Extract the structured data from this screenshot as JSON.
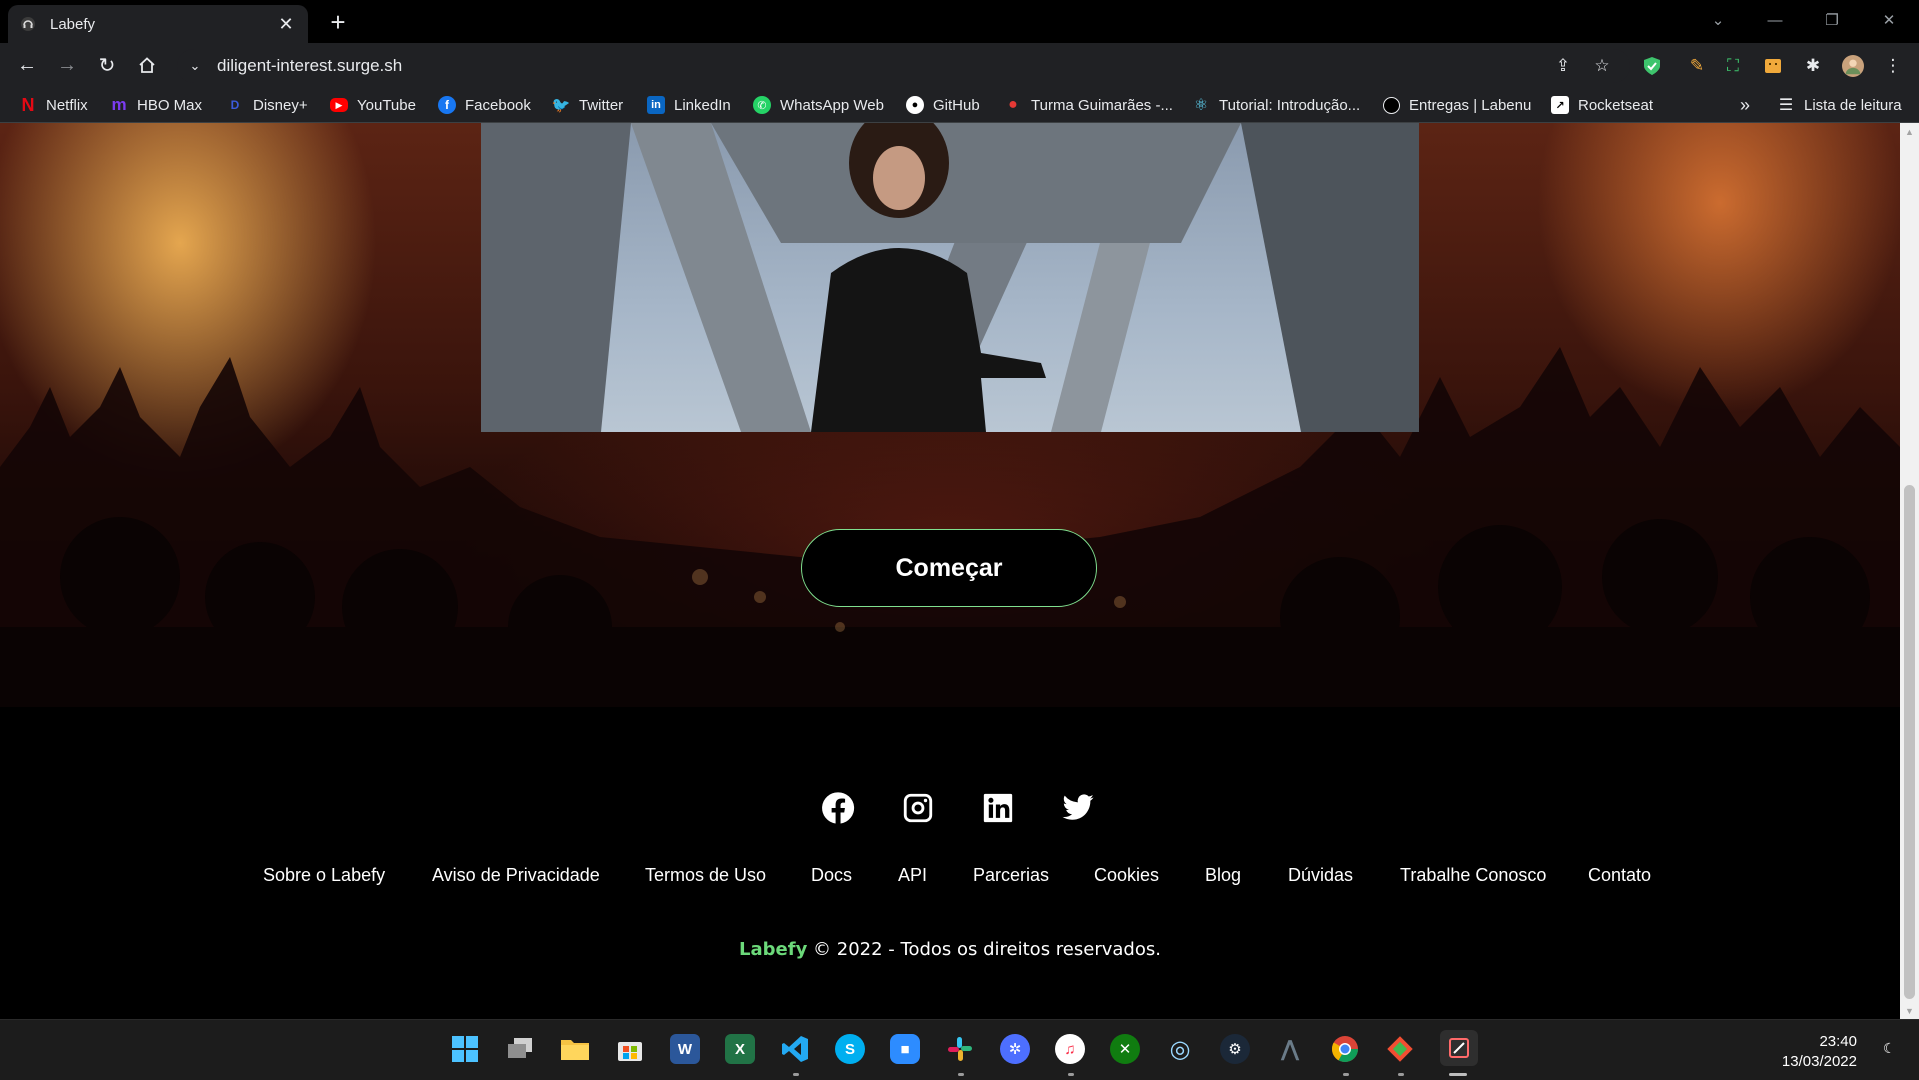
{
  "browser": {
    "tab_title": "Labefy",
    "url": "diligent-interest.surge.sh",
    "bookmarks": [
      {
        "label": "Netflix",
        "icon": "netflix-icon",
        "color": "#e50914"
      },
      {
        "label": "HBO Max",
        "icon": "hbo-max-icon",
        "color": "#5a2be2"
      },
      {
        "label": "Disney+",
        "icon": "disney-plus-icon",
        "color": "#1c3bb5"
      },
      {
        "label": "YouTube",
        "icon": "youtube-icon",
        "color": "#ff0000"
      },
      {
        "label": "Facebook",
        "icon": "facebook-icon",
        "color": "#1877f2"
      },
      {
        "label": "Twitter",
        "icon": "twitter-icon",
        "color": "#1da1f2"
      },
      {
        "label": "LinkedIn",
        "icon": "linkedin-icon",
        "color": "#0a66c2"
      },
      {
        "label": "WhatsApp Web",
        "icon": "whatsapp-icon",
        "color": "#25d366"
      },
      {
        "label": "GitHub",
        "icon": "github-icon",
        "color": "#ffffff"
      },
      {
        "label": "Turma Guimarães -...",
        "icon": "apple-icon",
        "color": "#e53935"
      },
      {
        "label": "Tutorial: Introdução...",
        "icon": "react-icon",
        "color": "#61dafb"
      },
      {
        "label": "Entregas | Labenu",
        "icon": "circle-icon",
        "color": "#000000"
      },
      {
        "label": "Rocketseat",
        "icon": "rocketseat-icon",
        "color": "#8257e5"
      }
    ],
    "more_bookmarks": "»",
    "reading_list": "Lista de leitura"
  },
  "page": {
    "start_button": "Começar",
    "footer_links": [
      "Sobre o Labefy",
      "Aviso de Privacidade",
      "Termos de Uso",
      "Docs",
      "API",
      "Parcerias",
      "Cookies",
      "Blog",
      "Dúvidas",
      "Trabalhe Conosco",
      "Contato"
    ],
    "copyright_brand": "Labefy",
    "copyright_text": " © 2022 - Todos os direitos reservados.",
    "brand_color": "#6cd97a"
  },
  "taskbar": {
    "time": "23:40",
    "date": "13/03/2022"
  }
}
